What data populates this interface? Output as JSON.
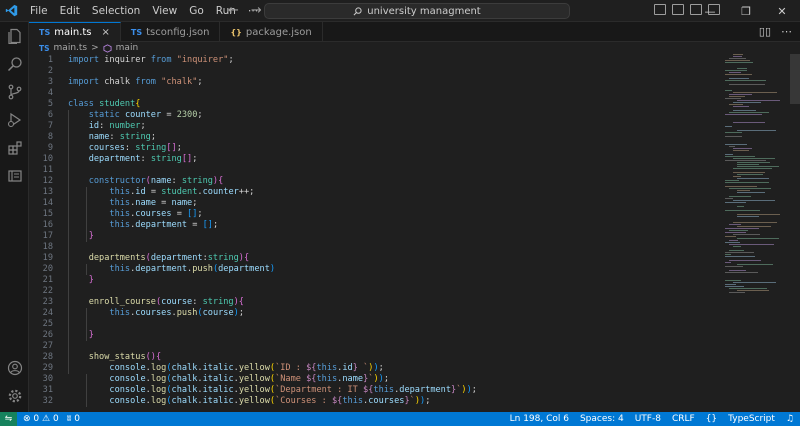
{
  "menu": [
    "File",
    "Edit",
    "Selection",
    "View",
    "Go",
    "Run",
    "⋯"
  ],
  "search": {
    "label": "university managment"
  },
  "tabs": [
    {
      "icon": "TS",
      "label": "main.ts",
      "active": true,
      "close": "×"
    },
    {
      "icon": "TS",
      "label": "tsconfig.json",
      "active": false
    },
    {
      "icon": "{}",
      "label": "package.json",
      "active": false
    }
  ],
  "breadcrumb": {
    "file_icon": "TS",
    "file": "main.ts",
    "sep": ">",
    "symbol": "main"
  },
  "code_lines": [
    [
      [
        "k",
        "import"
      ],
      [
        "p",
        " inquirer "
      ],
      [
        "k",
        "from"
      ],
      [
        "p",
        " "
      ],
      [
        "s",
        "\"inquirer\""
      ],
      [
        "p",
        ";"
      ]
    ],
    [],
    [
      [
        "k",
        "import"
      ],
      [
        "p",
        " chalk "
      ],
      [
        "k",
        "from"
      ],
      [
        "p",
        " "
      ],
      [
        "s",
        "\"chalk\""
      ],
      [
        "p",
        ";"
      ]
    ],
    [],
    [
      [
        "k",
        "class"
      ],
      [
        "p",
        " "
      ],
      [
        "cls",
        "student"
      ],
      [
        "b1",
        "{"
      ]
    ],
    [
      [
        "p",
        "    "
      ],
      [
        "k",
        "static"
      ],
      [
        "p",
        " "
      ],
      [
        "v",
        "counter"
      ],
      [
        "p",
        " = "
      ],
      [
        "n",
        "2300"
      ],
      [
        "p",
        ";"
      ]
    ],
    [
      [
        "p",
        "    "
      ],
      [
        "v",
        "id"
      ],
      [
        "p",
        ": "
      ],
      [
        "cls",
        "number"
      ],
      [
        "p",
        ";"
      ]
    ],
    [
      [
        "p",
        "    "
      ],
      [
        "v",
        "name"
      ],
      [
        "p",
        ": "
      ],
      [
        "cls",
        "string"
      ],
      [
        "p",
        ";"
      ]
    ],
    [
      [
        "p",
        "    "
      ],
      [
        "v",
        "courses"
      ],
      [
        "p",
        ": "
      ],
      [
        "cls",
        "string"
      ],
      [
        "b2",
        "[]"
      ],
      [
        "p",
        ";"
      ]
    ],
    [
      [
        "p",
        "    "
      ],
      [
        "v",
        "department"
      ],
      [
        "p",
        ": "
      ],
      [
        "cls",
        "string"
      ],
      [
        "b2",
        "[]"
      ],
      [
        "p",
        ";"
      ]
    ],
    [],
    [
      [
        "p",
        "    "
      ],
      [
        "k",
        "constructor"
      ],
      [
        "b2",
        "("
      ],
      [
        "v",
        "name"
      ],
      [
        "p",
        ": "
      ],
      [
        "cls",
        "string"
      ],
      [
        "b2",
        ")"
      ],
      [
        "b2",
        "{"
      ]
    ],
    [
      [
        "p",
        "        "
      ],
      [
        "k",
        "this"
      ],
      [
        "p",
        "."
      ],
      [
        "v",
        "id"
      ],
      [
        "p",
        " = "
      ],
      [
        "cls",
        "student"
      ],
      [
        "p",
        "."
      ],
      [
        "v",
        "counter"
      ],
      [
        "p",
        "++;"
      ]
    ],
    [
      [
        "p",
        "        "
      ],
      [
        "k",
        "this"
      ],
      [
        "p",
        "."
      ],
      [
        "v",
        "name"
      ],
      [
        "p",
        " = "
      ],
      [
        "v",
        "name"
      ],
      [
        "p",
        ";"
      ]
    ],
    [
      [
        "p",
        "        "
      ],
      [
        "k",
        "this"
      ],
      [
        "p",
        "."
      ],
      [
        "v",
        "courses"
      ],
      [
        "p",
        " = "
      ],
      [
        "b3",
        "[]"
      ],
      [
        "p",
        ";"
      ]
    ],
    [
      [
        "p",
        "        "
      ],
      [
        "k",
        "this"
      ],
      [
        "p",
        "."
      ],
      [
        "v",
        "department"
      ],
      [
        "p",
        " = "
      ],
      [
        "b3",
        "[]"
      ],
      [
        "p",
        ";"
      ]
    ],
    [
      [
        "p",
        "    "
      ],
      [
        "b2",
        "}"
      ]
    ],
    [],
    [
      [
        "p",
        "    "
      ],
      [
        "fn",
        "departments"
      ],
      [
        "b2",
        "("
      ],
      [
        "v",
        "department"
      ],
      [
        "p",
        ":"
      ],
      [
        "cls",
        "string"
      ],
      [
        "b2",
        ")"
      ],
      [
        "b2",
        "{"
      ]
    ],
    [
      [
        "p",
        "        "
      ],
      [
        "k",
        "this"
      ],
      [
        "p",
        "."
      ],
      [
        "v",
        "department"
      ],
      [
        "p",
        "."
      ],
      [
        "fn",
        "push"
      ],
      [
        "b3",
        "("
      ],
      [
        "v",
        "department"
      ],
      [
        "b3",
        ")"
      ]
    ],
    [
      [
        "p",
        "    "
      ],
      [
        "b2",
        "}"
      ]
    ],
    [],
    [
      [
        "p",
        "    "
      ],
      [
        "fn",
        "enroll_course"
      ],
      [
        "b2",
        "("
      ],
      [
        "v",
        "course"
      ],
      [
        "p",
        ": "
      ],
      [
        "cls",
        "string"
      ],
      [
        "b2",
        ")"
      ],
      [
        "b2",
        "{"
      ]
    ],
    [
      [
        "p",
        "        "
      ],
      [
        "k",
        "this"
      ],
      [
        "p",
        "."
      ],
      [
        "v",
        "courses"
      ],
      [
        "p",
        "."
      ],
      [
        "fn",
        "push"
      ],
      [
        "b3",
        "("
      ],
      [
        "v",
        "course"
      ],
      [
        "b3",
        ")"
      ],
      [
        "p",
        ";"
      ]
    ],
    [],
    [
      [
        "p",
        "    "
      ],
      [
        "b2",
        "}"
      ]
    ],
    [],
    [
      [
        "p",
        "    "
      ],
      [
        "fn",
        "show_status"
      ],
      [
        "b2",
        "()"
      ],
      [
        "b2",
        "{"
      ]
    ],
    [
      [
        "p",
        "        "
      ],
      [
        "v",
        "console"
      ],
      [
        "p",
        "."
      ],
      [
        "fn",
        "log"
      ],
      [
        "b3",
        "("
      ],
      [
        "v",
        "chalk"
      ],
      [
        "p",
        "."
      ],
      [
        "v",
        "italic"
      ],
      [
        "p",
        "."
      ],
      [
        "fn",
        "yellow"
      ],
      [
        "b1",
        "("
      ],
      [
        "s",
        "`ID : "
      ],
      [
        "kc",
        "${"
      ],
      [
        "k",
        "this"
      ],
      [
        "p",
        "."
      ],
      [
        "v",
        "id"
      ],
      [
        "kc",
        "}"
      ],
      [
        "s",
        " `"
      ],
      [
        "b1",
        ")"
      ],
      [
        "b3",
        ")"
      ],
      [
        "p",
        ";"
      ]
    ],
    [
      [
        "p",
        "        "
      ],
      [
        "v",
        "console"
      ],
      [
        "p",
        "."
      ],
      [
        "fn",
        "log"
      ],
      [
        "b3",
        "("
      ],
      [
        "v",
        "chalk"
      ],
      [
        "p",
        "."
      ],
      [
        "v",
        "italic"
      ],
      [
        "p",
        "."
      ],
      [
        "fn",
        "yellow"
      ],
      [
        "b1",
        "("
      ],
      [
        "s",
        "`Name "
      ],
      [
        "kc",
        "${"
      ],
      [
        "k",
        "this"
      ],
      [
        "p",
        "."
      ],
      [
        "v",
        "name"
      ],
      [
        "kc",
        "}"
      ],
      [
        "s",
        "`"
      ],
      [
        "b1",
        ")"
      ],
      [
        "b3",
        ")"
      ],
      [
        "p",
        ";"
      ]
    ],
    [
      [
        "p",
        "        "
      ],
      [
        "v",
        "console"
      ],
      [
        "p",
        "."
      ],
      [
        "fn",
        "log"
      ],
      [
        "b3",
        "("
      ],
      [
        "v",
        "chalk"
      ],
      [
        "p",
        "."
      ],
      [
        "v",
        "italic"
      ],
      [
        "p",
        "."
      ],
      [
        "fn",
        "yellow"
      ],
      [
        "b1",
        "("
      ],
      [
        "s",
        "`Department : IT "
      ],
      [
        "kc",
        "${"
      ],
      [
        "k",
        "this"
      ],
      [
        "p",
        "."
      ],
      [
        "v",
        "department"
      ],
      [
        "kc",
        "}"
      ],
      [
        "s",
        "`"
      ],
      [
        "b1",
        ")"
      ],
      [
        "b3",
        ")"
      ],
      [
        "p",
        ";"
      ]
    ],
    [
      [
        "p",
        "        "
      ],
      [
        "v",
        "console"
      ],
      [
        "p",
        "."
      ],
      [
        "fn",
        "log"
      ],
      [
        "b3",
        "("
      ],
      [
        "v",
        "chalk"
      ],
      [
        "p",
        "."
      ],
      [
        "v",
        "italic"
      ],
      [
        "p",
        "."
      ],
      [
        "fn",
        "yellow"
      ],
      [
        "b1",
        "("
      ],
      [
        "s",
        "`Courses : "
      ],
      [
        "kc",
        "${"
      ],
      [
        "k",
        "this"
      ],
      [
        "p",
        "."
      ],
      [
        "v",
        "courses"
      ],
      [
        "kc",
        "}"
      ],
      [
        "s",
        "`"
      ],
      [
        "b1",
        ")"
      ],
      [
        "b3",
        ")"
      ],
      [
        "p",
        ";"
      ]
    ]
  ],
  "status": {
    "remote_icon": "remote-icon",
    "errors": "0",
    "warnings": "0",
    "ports": "0",
    "position": "Ln 198, Col 6",
    "spaces": "Spaces: 4",
    "encoding": "UTF-8",
    "eol": "CRLF",
    "braces": "{}",
    "language": "TypeScript"
  },
  "colors": {
    "accent": "#0078d4",
    "remote": "#16825d",
    "editor_bg": "#1f1f1f"
  }
}
